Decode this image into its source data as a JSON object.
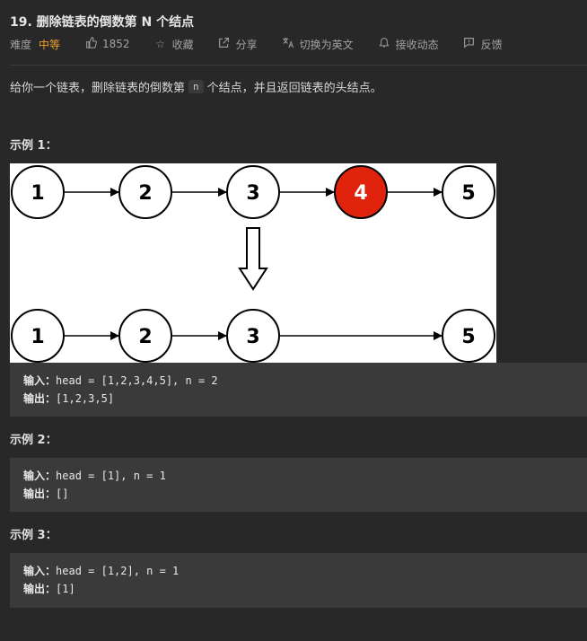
{
  "problem": {
    "title": "19. 删除链表的倒数第 N 个结点",
    "meta": {
      "difficulty_label": "难度",
      "difficulty_value": "中等",
      "likes": "1852",
      "favorite_label": "收藏",
      "share_label": "分享",
      "switch_lang_label": "切换为英文",
      "follow_label": "接收动态",
      "feedback_label": "反馈"
    },
    "description": {
      "before": "给你一个链表，删除链表的倒数第",
      "code": "n",
      "after": "个结点，并且返回链表的头结点。"
    }
  },
  "diagram": {
    "top_row": [
      "1",
      "2",
      "3",
      "4",
      "5"
    ],
    "bottom_row": [
      "1",
      "2",
      "3",
      "5"
    ],
    "highlight_node": "4",
    "colors": {
      "highlight": "#e0230c",
      "node": "#ffffff",
      "stroke": "#000000"
    }
  },
  "examples": [
    {
      "title": "示例 1：",
      "input_label": "输入：",
      "input_value": "head = [1,2,3,4,5], n = 2",
      "output_label": "输出：",
      "output_value": "[1,2,3,5]"
    },
    {
      "title": "示例 2：",
      "input_label": "输入：",
      "input_value": "head = [1], n = 1",
      "output_label": "输出：",
      "output_value": "[]"
    },
    {
      "title": "示例 3：",
      "input_label": "输入：",
      "input_value": "head = [1,2], n = 1",
      "output_label": "输出：",
      "output_value": "[1]"
    }
  ],
  "icons": {
    "like": "thumbs-up-icon",
    "favorite": "star-icon",
    "share": "share-icon",
    "translate": "translate-icon",
    "bell": "bell-icon",
    "feedback": "feedback-icon"
  }
}
